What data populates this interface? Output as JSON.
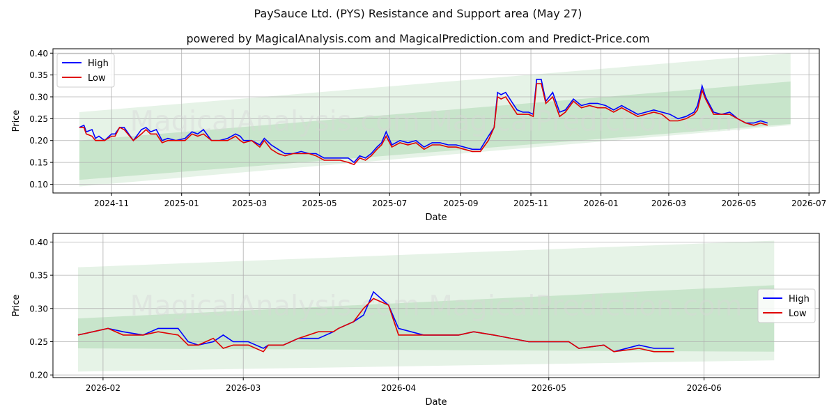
{
  "title": "PaySauce Ltd. (PYS) Resistance and Support area (May 27)",
  "subtitle": "powered by MagicalAnalysis.com and MagicalPrediction.com and Predict-Price.com",
  "watermark": "MagicalAnalysis.com   MagicalPrediction.com",
  "colors": {
    "high": "#0000ff",
    "low": "#e00000",
    "band": "#2e9e3a",
    "grid": "#b0b0b0"
  },
  "chart_data": [
    {
      "type": "line",
      "xlabel": "Date",
      "ylabel": "Price",
      "xlim": [
        "2024-09-11",
        "2026-07-10"
      ],
      "ylim": [
        0.08,
        0.41
      ],
      "yticks": [
        0.1,
        0.15,
        0.2,
        0.25,
        0.3,
        0.35,
        0.4
      ],
      "xticks": [
        "2024-11-01",
        "2025-01-01",
        "2025-03-01",
        "2025-05-01",
        "2025-07-01",
        "2025-09-01",
        "2025-11-01",
        "2026-01-01",
        "2026-03-01",
        "2026-05-01",
        "2026-07-01"
      ],
      "xtick_labels": [
        "2024-11",
        "2025-01",
        "2025-03",
        "2025-05",
        "2025-07",
        "2025-09",
        "2025-11",
        "2026-01",
        "2026-03",
        "2026-05",
        "2026-07"
      ],
      "grid": true,
      "legend": "top-left",
      "bands": [
        {
          "x": [
            "2024-10-04",
            "2026-06-15"
          ],
          "lower": [
            0.095,
            0.235
          ],
          "upper": [
            0.265,
            0.4
          ],
          "opacity": 0.12
        },
        {
          "x": [
            "2024-10-04",
            "2026-06-15"
          ],
          "lower": [
            0.11,
            0.238
          ],
          "upper": [
            0.2,
            0.335
          ],
          "opacity": 0.16
        }
      ],
      "series": [
        {
          "name": "High",
          "x": [
            "2024-10-04",
            "2024-10-08",
            "2024-10-10",
            "2024-10-15",
            "2024-10-18",
            "2024-10-21",
            "2024-10-26",
            "2024-11-01",
            "2024-11-04",
            "2024-11-08",
            "2024-11-12",
            "2024-11-20",
            "2024-11-27",
            "2024-12-01",
            "2024-12-05",
            "2024-12-10",
            "2024-12-15",
            "2024-12-20",
            "2024-12-27",
            "2025-01-04",
            "2025-01-10",
            "2025-01-15",
            "2025-01-20",
            "2025-01-27",
            "2025-02-03",
            "2025-02-10",
            "2025-02-17",
            "2025-02-21",
            "2025-02-24",
            "2025-03-03",
            "2025-03-10",
            "2025-03-14",
            "2025-03-20",
            "2025-03-26",
            "2025-04-01",
            "2025-04-08",
            "2025-04-15",
            "2025-04-22",
            "2025-04-28",
            "2025-05-05",
            "2025-05-12",
            "2025-05-19",
            "2025-05-26",
            "2025-05-31",
            "2025-06-05",
            "2025-06-10",
            "2025-06-15",
            "2025-06-20",
            "2025-06-24",
            "2025-06-28",
            "2025-07-03",
            "2025-07-10",
            "2025-07-17",
            "2025-07-24",
            "2025-07-31",
            "2025-08-07",
            "2025-08-14",
            "2025-08-21",
            "2025-08-28",
            "2025-09-04",
            "2025-09-11",
            "2025-09-18",
            "2025-09-25",
            "2025-09-30",
            "2025-10-03",
            "2025-10-06",
            "2025-10-10",
            "2025-10-15",
            "2025-10-20",
            "2025-10-25",
            "2025-10-30",
            "2025-11-03",
            "2025-11-06",
            "2025-11-10",
            "2025-11-14",
            "2025-11-20",
            "2025-11-26",
            "2025-12-01",
            "2025-12-08",
            "2025-12-15",
            "2025-12-22",
            "2025-12-29",
            "2026-01-05",
            "2026-01-12",
            "2026-01-19",
            "2026-01-26",
            "2026-02-02",
            "2026-02-09",
            "2026-02-16",
            "2026-02-23",
            "2026-03-02",
            "2026-03-09",
            "2026-03-16",
            "2026-03-23",
            "2026-03-26",
            "2026-03-30",
            "2026-04-02",
            "2026-04-09",
            "2026-04-16",
            "2026-04-23",
            "2026-04-30",
            "2026-05-07",
            "2026-05-14",
            "2026-05-20",
            "2026-05-26"
          ],
          "values": [
            0.23,
            0.235,
            0.22,
            0.225,
            0.205,
            0.21,
            0.2,
            0.215,
            0.215,
            0.23,
            0.23,
            0.2,
            0.225,
            0.23,
            0.22,
            0.225,
            0.2,
            0.205,
            0.2,
            0.205,
            0.22,
            0.215,
            0.225,
            0.2,
            0.2,
            0.205,
            0.215,
            0.21,
            0.2,
            0.2,
            0.19,
            0.205,
            0.19,
            0.18,
            0.17,
            0.17,
            0.175,
            0.17,
            0.17,
            0.16,
            0.16,
            0.16,
            0.16,
            0.15,
            0.165,
            0.16,
            0.17,
            0.185,
            0.195,
            0.22,
            0.19,
            0.2,
            0.195,
            0.2,
            0.185,
            0.195,
            0.195,
            0.19,
            0.19,
            0.185,
            0.18,
            0.18,
            0.21,
            0.23,
            0.31,
            0.305,
            0.31,
            0.29,
            0.27,
            0.265,
            0.265,
            0.26,
            0.34,
            0.34,
            0.29,
            0.31,
            0.265,
            0.27,
            0.295,
            0.28,
            0.285,
            0.285,
            0.28,
            0.27,
            0.28,
            0.27,
            0.26,
            0.265,
            0.27,
            0.265,
            0.26,
            0.25,
            0.255,
            0.265,
            0.28,
            0.325,
            0.3,
            0.265,
            0.26,
            0.265,
            0.25,
            0.24,
            0.24,
            0.245,
            0.24
          ]
        },
        {
          "name": "Low",
          "x": [
            "2024-10-04",
            "2024-10-08",
            "2024-10-10",
            "2024-10-15",
            "2024-10-18",
            "2024-10-21",
            "2024-10-26",
            "2024-11-01",
            "2024-11-04",
            "2024-11-08",
            "2024-11-12",
            "2024-11-20",
            "2024-11-27",
            "2024-12-01",
            "2024-12-05",
            "2024-12-10",
            "2024-12-15",
            "2024-12-20",
            "2024-12-27",
            "2025-01-04",
            "2025-01-10",
            "2025-01-15",
            "2025-01-20",
            "2025-01-27",
            "2025-02-03",
            "2025-02-10",
            "2025-02-17",
            "2025-02-21",
            "2025-02-24",
            "2025-03-03",
            "2025-03-10",
            "2025-03-14",
            "2025-03-20",
            "2025-03-26",
            "2025-04-01",
            "2025-04-08",
            "2025-04-15",
            "2025-04-22",
            "2025-04-28",
            "2025-05-05",
            "2025-05-12",
            "2025-05-19",
            "2025-05-26",
            "2025-05-31",
            "2025-06-05",
            "2025-06-10",
            "2025-06-15",
            "2025-06-20",
            "2025-06-24",
            "2025-06-28",
            "2025-07-03",
            "2025-07-10",
            "2025-07-17",
            "2025-07-24",
            "2025-07-31",
            "2025-08-07",
            "2025-08-14",
            "2025-08-21",
            "2025-08-28",
            "2025-09-04",
            "2025-09-11",
            "2025-09-18",
            "2025-09-25",
            "2025-09-30",
            "2025-10-03",
            "2025-10-06",
            "2025-10-10",
            "2025-10-15",
            "2025-10-20",
            "2025-10-25",
            "2025-10-30",
            "2025-11-03",
            "2025-11-06",
            "2025-11-10",
            "2025-11-14",
            "2025-11-20",
            "2025-11-26",
            "2025-12-01",
            "2025-12-08",
            "2025-12-15",
            "2025-12-22",
            "2025-12-29",
            "2026-01-05",
            "2026-01-12",
            "2026-01-19",
            "2026-01-26",
            "2026-02-02",
            "2026-02-09",
            "2026-02-16",
            "2026-02-23",
            "2026-03-02",
            "2026-03-09",
            "2026-03-16",
            "2026-03-23",
            "2026-03-26",
            "2026-03-30",
            "2026-04-02",
            "2026-04-09",
            "2026-04-16",
            "2026-04-23",
            "2026-04-30",
            "2026-05-07",
            "2026-05-14",
            "2026-05-20",
            "2026-05-26"
          ],
          "values": [
            0.23,
            0.23,
            0.215,
            0.21,
            0.2,
            0.2,
            0.2,
            0.21,
            0.21,
            0.23,
            0.225,
            0.2,
            0.215,
            0.225,
            0.215,
            0.215,
            0.195,
            0.2,
            0.2,
            0.2,
            0.215,
            0.21,
            0.215,
            0.2,
            0.2,
            0.2,
            0.21,
            0.2,
            0.195,
            0.2,
            0.185,
            0.2,
            0.18,
            0.17,
            0.165,
            0.17,
            0.17,
            0.17,
            0.165,
            0.155,
            0.155,
            0.155,
            0.15,
            0.145,
            0.16,
            0.155,
            0.165,
            0.18,
            0.19,
            0.21,
            0.185,
            0.195,
            0.19,
            0.195,
            0.18,
            0.19,
            0.19,
            0.185,
            0.185,
            0.18,
            0.175,
            0.175,
            0.2,
            0.23,
            0.3,
            0.295,
            0.3,
            0.28,
            0.26,
            0.26,
            0.26,
            0.255,
            0.33,
            0.33,
            0.285,
            0.3,
            0.255,
            0.265,
            0.29,
            0.275,
            0.28,
            0.275,
            0.275,
            0.265,
            0.275,
            0.265,
            0.255,
            0.26,
            0.265,
            0.26,
            0.245,
            0.245,
            0.25,
            0.26,
            0.27,
            0.315,
            0.295,
            0.26,
            0.26,
            0.26,
            0.25,
            0.24,
            0.235,
            0.24,
            0.235
          ]
        }
      ]
    },
    {
      "type": "line",
      "xlabel": "Date",
      "ylabel": "Price",
      "xlim": [
        "2026-01-22",
        "2026-06-24"
      ],
      "ylim": [
        0.196,
        0.413
      ],
      "yticks": [
        0.2,
        0.25,
        0.3,
        0.35,
        0.4
      ],
      "xticks": [
        "2026-02-01",
        "2026-03-01",
        "2026-04-01",
        "2026-05-01",
        "2026-06-01"
      ],
      "xtick_labels": [
        "2026-02",
        "2026-03",
        "2026-04",
        "2026-05",
        "2026-06"
      ],
      "grid": true,
      "legend": "center-right",
      "bands": [
        {
          "x": [
            "2026-01-27",
            "2026-06-15"
          ],
          "lower": [
            0.205,
            0.222
          ],
          "upper": [
            0.362,
            0.402
          ],
          "opacity": 0.12
        },
        {
          "x": [
            "2026-01-27",
            "2026-06-15"
          ],
          "lower": [
            0.24,
            0.235
          ],
          "upper": [
            0.285,
            0.335
          ],
          "opacity": 0.16
        }
      ],
      "series": [
        {
          "name": "High",
          "x": [
            "2026-01-27",
            "2026-01-30",
            "2026-02-02",
            "2026-02-05",
            "2026-02-09",
            "2026-02-12",
            "2026-02-16",
            "2026-02-18",
            "2026-02-20",
            "2026-02-23",
            "2026-02-25",
            "2026-02-27",
            "2026-03-02",
            "2026-03-05",
            "2026-03-06",
            "2026-03-09",
            "2026-03-12",
            "2026-03-16",
            "2026-03-19",
            "2026-03-20",
            "2026-03-23",
            "2026-03-25",
            "2026-03-27",
            "2026-03-30",
            "2026-04-01",
            "2026-04-06",
            "2026-04-13",
            "2026-04-16",
            "2026-04-20",
            "2026-04-27",
            "2026-04-30",
            "2026-05-05",
            "2026-05-07",
            "2026-05-12",
            "2026-05-14",
            "2026-05-19",
            "2026-05-22",
            "2026-05-26"
          ],
          "values": [
            0.26,
            0.265,
            0.27,
            0.265,
            0.26,
            0.27,
            0.27,
            0.25,
            0.245,
            0.25,
            0.26,
            0.25,
            0.25,
            0.24,
            0.245,
            0.245,
            0.255,
            0.255,
            0.265,
            0.27,
            0.28,
            0.29,
            0.325,
            0.305,
            0.27,
            0.26,
            0.26,
            0.265,
            0.26,
            0.25,
            0.25,
            0.25,
            0.24,
            0.245,
            0.235,
            0.245,
            0.24,
            0.24
          ]
        },
        {
          "name": "Low",
          "x": [
            "2026-01-27",
            "2026-01-30",
            "2026-02-02",
            "2026-02-05",
            "2026-02-09",
            "2026-02-12",
            "2026-02-16",
            "2026-02-18",
            "2026-02-20",
            "2026-02-23",
            "2026-02-25",
            "2026-02-27",
            "2026-03-02",
            "2026-03-05",
            "2026-03-06",
            "2026-03-09",
            "2026-03-12",
            "2026-03-16",
            "2026-03-19",
            "2026-03-20",
            "2026-03-23",
            "2026-03-25",
            "2026-03-27",
            "2026-03-30",
            "2026-04-01",
            "2026-04-06",
            "2026-04-13",
            "2026-04-16",
            "2026-04-20",
            "2026-04-27",
            "2026-04-30",
            "2026-05-05",
            "2026-05-07",
            "2026-05-12",
            "2026-05-14",
            "2026-05-19",
            "2026-05-22",
            "2026-05-26"
          ],
          "values": [
            0.26,
            0.265,
            0.27,
            0.26,
            0.26,
            0.265,
            0.26,
            0.245,
            0.245,
            0.255,
            0.24,
            0.245,
            0.245,
            0.235,
            0.245,
            0.245,
            0.255,
            0.265,
            0.265,
            0.27,
            0.28,
            0.3,
            0.315,
            0.305,
            0.26,
            0.26,
            0.26,
            0.265,
            0.26,
            0.25,
            0.25,
            0.25,
            0.24,
            0.245,
            0.235,
            0.24,
            0.235,
            0.235
          ]
        }
      ]
    }
  ]
}
